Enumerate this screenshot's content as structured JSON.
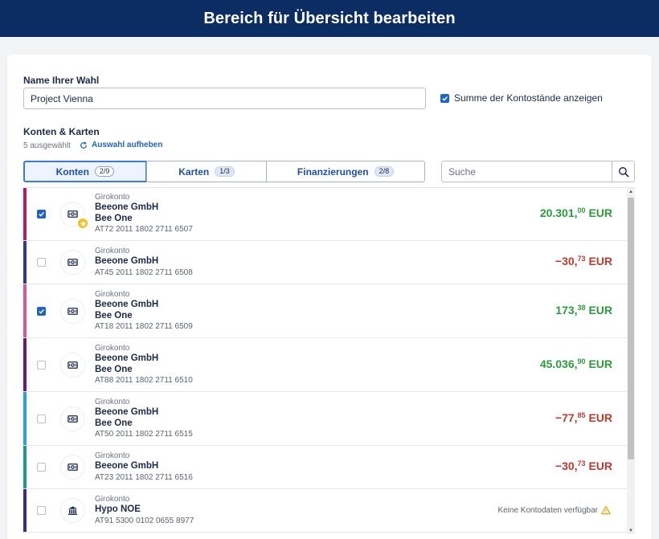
{
  "header": {
    "title": "Bereich für Übersicht bearbeiten"
  },
  "form": {
    "name_label": "Name Ihrer Wahl",
    "name_value": "Project Vienna",
    "sum_label": "Summe der Kontostände anzeigen",
    "sum_checked": true
  },
  "accounts_section": {
    "title": "Konten & Karten",
    "selected_count": "5 ausgewählt",
    "reset_label": "Auswahl aufheben"
  },
  "tabs": [
    {
      "label": "Konten",
      "count": "2/9",
      "active": true
    },
    {
      "label": "Karten",
      "count": "1/3",
      "active": false
    },
    {
      "label": "Finanzierungen",
      "count": "2/8",
      "active": false
    }
  ],
  "search": {
    "placeholder": "Suche"
  },
  "accounts": [
    {
      "type": "Girokonto",
      "name1": "Beeone GmbH",
      "name2": "Bee One",
      "iban": "AT72 2011 1802 2711 6507",
      "amount_int": "20.301",
      "amount_dec": "00",
      "currency": "EUR",
      "sign": "pos",
      "checked": true,
      "favorite": true,
      "stripe": "#c2185b",
      "icon": "banknote-icon"
    },
    {
      "type": "Girokonto",
      "name1": "Beeone GmbH",
      "name2": "",
      "iban": "AT45 2011 1802 2711 6508",
      "amount_int": "−30",
      "amount_dec": "73",
      "currency": "EUR",
      "sign": "neg",
      "checked": false,
      "favorite": false,
      "stripe": "#2e3a8c",
      "icon": "banknote-icon"
    },
    {
      "type": "Girokonto",
      "name1": "Beeone GmbH",
      "name2": "Bee One",
      "iban": "AT18 2011 1802 2711 6509",
      "amount_int": "173",
      "amount_dec": "38",
      "currency": "EUR",
      "sign": "pos",
      "checked": true,
      "favorite": false,
      "stripe": "#e0558a",
      "icon": "banknote-icon"
    },
    {
      "type": "Girokonto",
      "name1": "Beeone GmbH",
      "name2": "Bee One",
      "iban": "AT88 2011 1802 2711 6510",
      "amount_int": "45.036",
      "amount_dec": "90",
      "currency": "EUR",
      "sign": "pos",
      "checked": false,
      "favorite": false,
      "stripe": "#6a1b7a",
      "icon": "banknote-icon"
    },
    {
      "type": "Girokonto",
      "name1": "Beeone GmbH",
      "name2": "Bee One",
      "iban": "AT50 2011 1802 2711 6515",
      "amount_int": "−77",
      "amount_dec": "85",
      "currency": "EUR",
      "sign": "neg",
      "checked": false,
      "favorite": false,
      "stripe": "#29a3e0",
      "icon": "banknote-icon"
    },
    {
      "type": "Girokonto",
      "name1": "Beeone GmbH",
      "name2": "",
      "iban": "AT23 2011 1802 2711 6516",
      "amount_int": "−30",
      "amount_dec": "73",
      "currency": "EUR",
      "sign": "neg",
      "checked": false,
      "favorite": false,
      "stripe": "#1a9a8a",
      "icon": "banknote-icon"
    },
    {
      "type": "Girokonto",
      "name1": "Hypo NOE",
      "name2": "",
      "iban": "AT91 5300 0102 0655 8977",
      "nodata": "Keine Kontodaten verfügbar",
      "checked": false,
      "favorite": false,
      "stripe": "#3a2a8c",
      "icon": "bank-building-icon"
    }
  ]
}
